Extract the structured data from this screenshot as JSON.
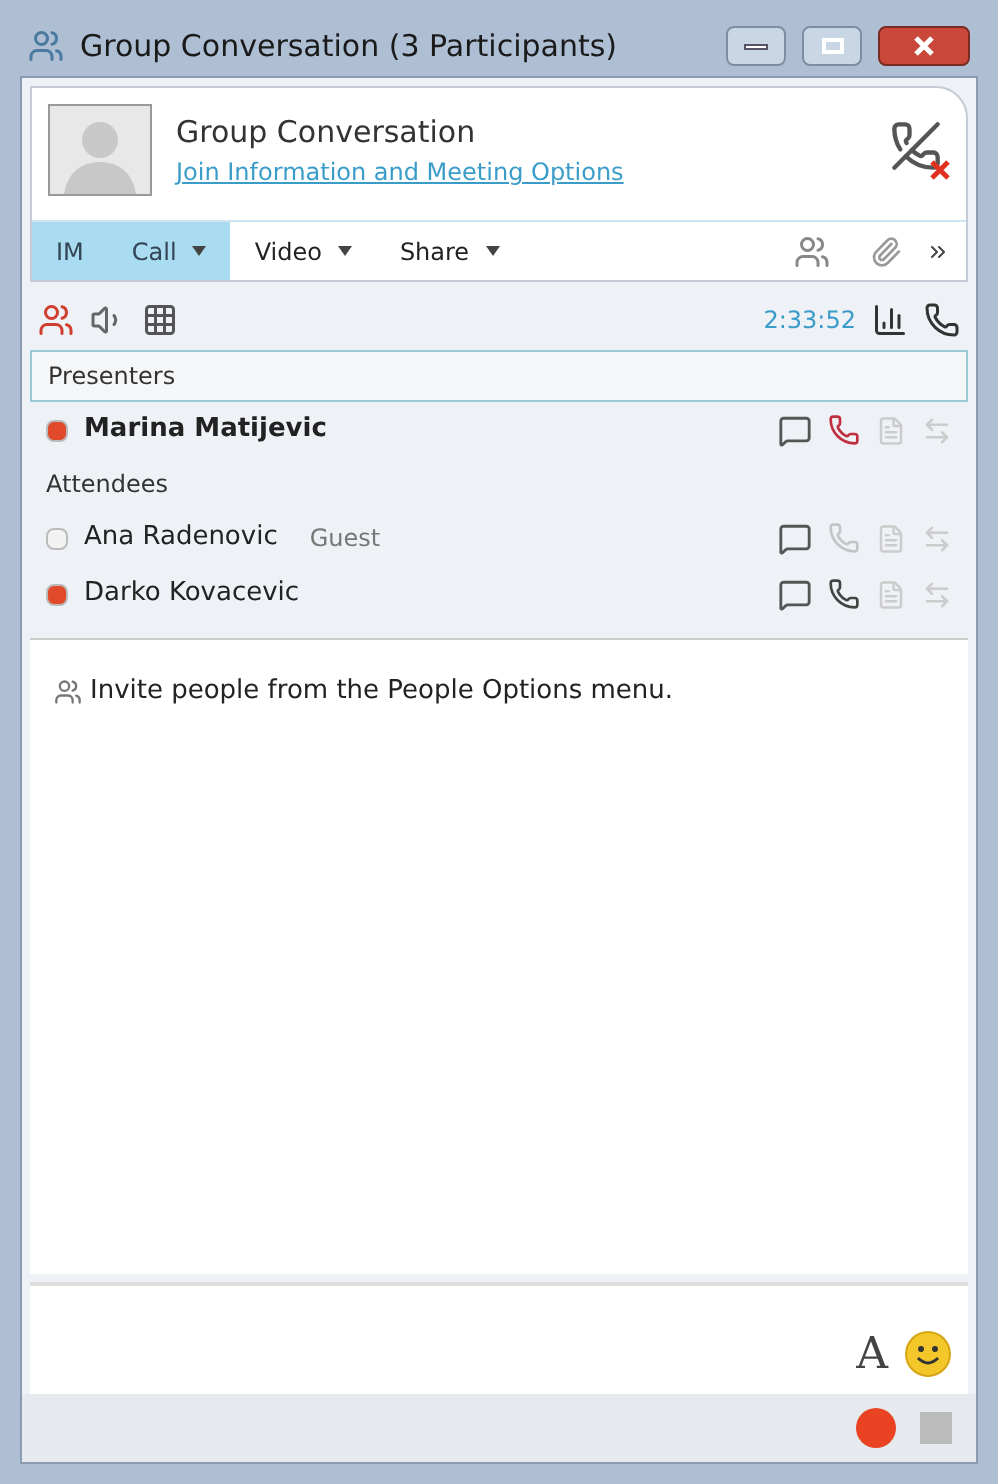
{
  "window": {
    "title": "Group Conversation (3 Participants)"
  },
  "header": {
    "title": "Group Conversation",
    "link": "Join Information and Meeting Options"
  },
  "tabs": [
    {
      "label": "IM",
      "selected": true,
      "dropdown": false
    },
    {
      "label": "Call",
      "selected": true,
      "dropdown": true
    },
    {
      "label": "Video",
      "selected": false,
      "dropdown": true
    },
    {
      "label": "Share",
      "selected": false,
      "dropdown": true
    }
  ],
  "call_bar": {
    "duration": "2:33:52"
  },
  "roster": [
    {
      "heading": "Presenters",
      "people": [
        {
          "name": "Marina Matijevic",
          "color": "#e04a2a",
          "in_call": true,
          "call_enabled": true
        }
      ]
    },
    {
      "heading": "Attendees",
      "people": [
        {
          "name": "Ana Radenovic",
          "color": "#f2f2f2",
          "tag": "Guest",
          "in_call": false,
          "call_enabled": false
        },
        {
          "name": "Darko Kovacevic",
          "color": "#e04a2a",
          "in_call": false,
          "call_enabled": true
        }
      ]
    }
  ],
  "message": "Invite people from the People Options menu.",
  "compose": {
    "font_button": "A"
  },
  "status_bar": {
    "recording": true
  }
}
